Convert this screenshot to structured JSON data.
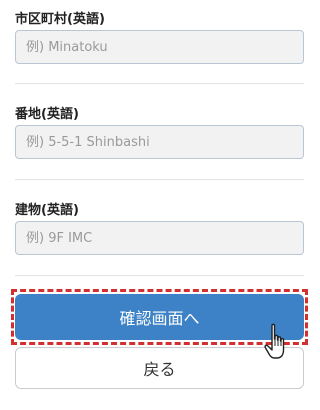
{
  "form": {
    "city": {
      "label": "市区町村(英語)",
      "placeholder": "例) Minatoku",
      "value": ""
    },
    "street": {
      "label": "番地(英語)",
      "placeholder": "例) 5-5-1 Shinbashi",
      "value": ""
    },
    "building": {
      "label": "建物(英語)",
      "placeholder": "例) 9F IMC",
      "value": ""
    }
  },
  "actions": {
    "confirm_label": "確認画面へ",
    "back_label": "戻る"
  },
  "highlight": {
    "frame_color": "#d32f2f",
    "pointer_icon": "pointing-hand-cursor-icon"
  },
  "colors": {
    "primary_button": "#3d82c6",
    "input_background": "#f2f2f2",
    "input_border": "#b9c6d3"
  }
}
